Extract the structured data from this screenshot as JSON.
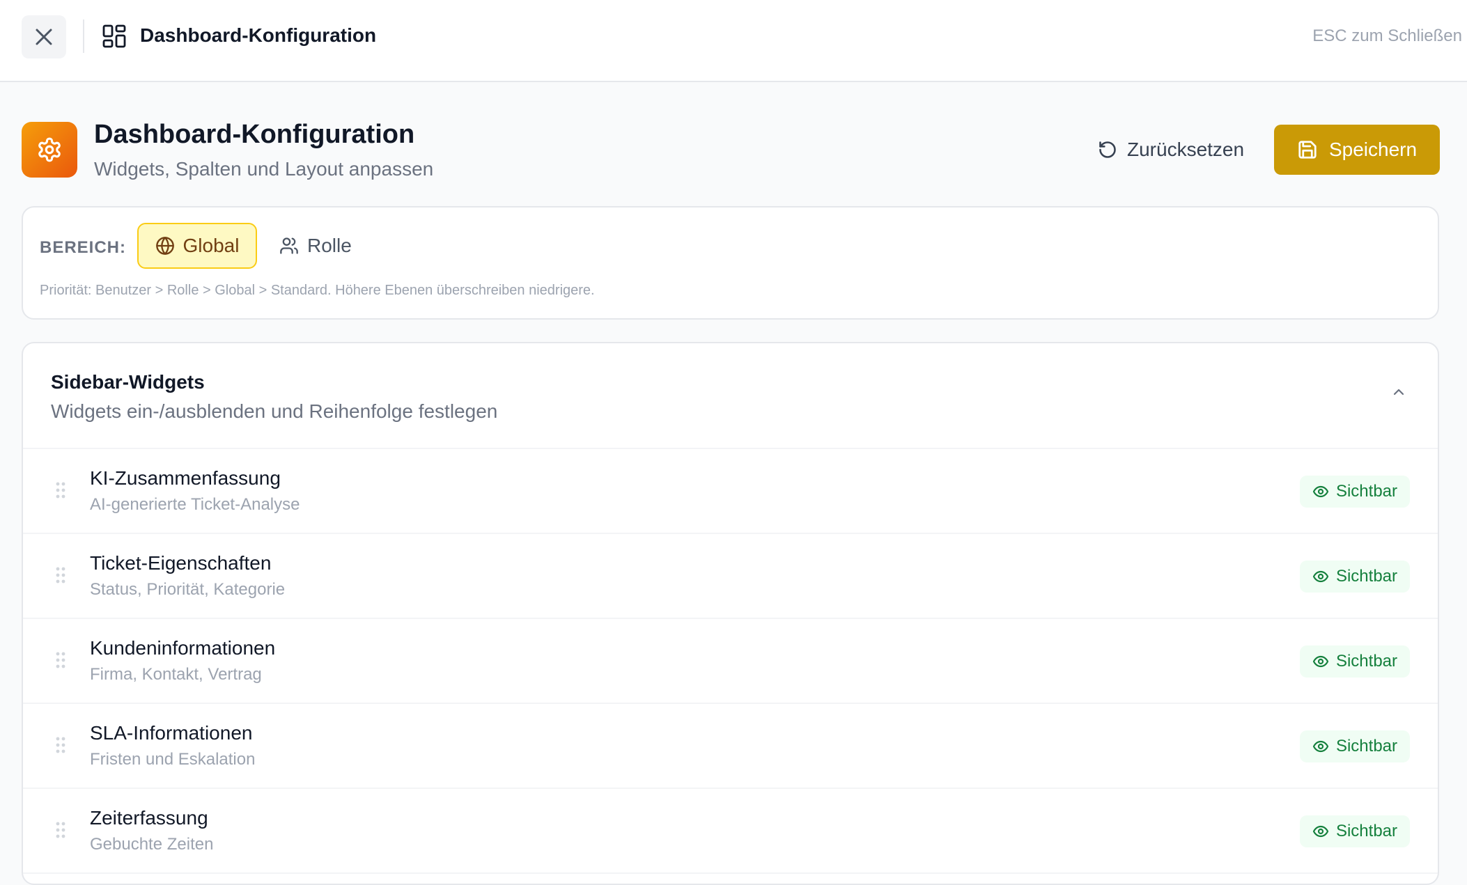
{
  "topbar": {
    "title": "Dashboard-Konfiguration",
    "esc_hint": "ESC zum Schließen"
  },
  "header": {
    "title": "Dashboard-Konfiguration",
    "subtitle": "Widgets, Spalten und Layout anpassen",
    "reset_label": "Zurücksetzen",
    "save_label": "Speichern"
  },
  "scope": {
    "label": "BEREICH:",
    "options": [
      {
        "label": "Global",
        "selected": true
      },
      {
        "label": "Rolle",
        "selected": false
      }
    ],
    "note": "Priorität: Benutzer > Rolle > Global > Standard. Höhere Ebenen überschreiben niedrigere."
  },
  "widgets": {
    "title": "Sidebar-Widgets",
    "subtitle": "Widgets ein-/ausblenden und Reihenfolge festlegen",
    "items": [
      {
        "name": "KI-Zusammenfassung",
        "description": "AI-generierte Ticket-Analyse",
        "status": "Sichtbar"
      },
      {
        "name": "Ticket-Eigenschaften",
        "description": "Status, Priorität, Kategorie",
        "status": "Sichtbar"
      },
      {
        "name": "Kundeninformationen",
        "description": "Firma, Kontakt, Vertrag",
        "status": "Sichtbar"
      },
      {
        "name": "SLA-Informationen",
        "description": "Fristen und Eskalation",
        "status": "Sichtbar"
      },
      {
        "name": "Zeiterfassung",
        "description": "Gebuchte Zeiten",
        "status": "Sichtbar"
      }
    ]
  },
  "colors": {
    "accent": "#ca9a06",
    "icon_gradient_start": "#f59e0b",
    "icon_gradient_end": "#ea580c",
    "visible_green": "#15803d"
  }
}
